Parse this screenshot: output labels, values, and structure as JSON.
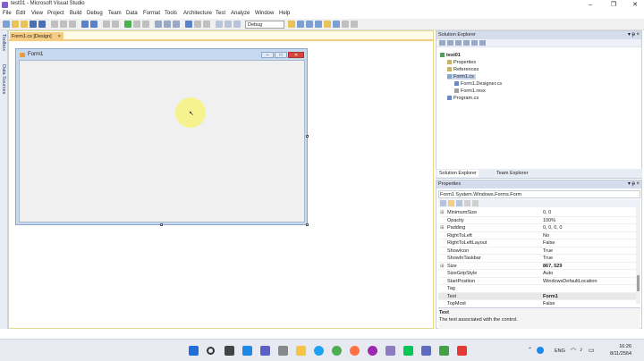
{
  "window": {
    "title": "test01 - Microsoft Visual Studio",
    "controls": [
      "–",
      "❐",
      "✕"
    ]
  },
  "menu": [
    "File",
    "Edit",
    "View",
    "Project",
    "Build",
    "Debug",
    "Team",
    "Data",
    "Format",
    "Tools",
    "Architecture",
    "Test",
    "Analyze",
    "Window",
    "Help"
  ],
  "toolbar": {
    "configuration": "Debug"
  },
  "left_tabs": {
    "toolbox": "Toolbox",
    "data_sources": "Data Sources"
  },
  "document_tab": {
    "label": "Form1.cs [Design]",
    "close": "×"
  },
  "form": {
    "caption": "Form1"
  },
  "solution_explorer": {
    "title": "Solution Explorer",
    "pin": "▾ ᵽ ×",
    "items": [
      {
        "label": "test01",
        "bold": true
      },
      {
        "label": "Properties"
      },
      {
        "label": "References"
      },
      {
        "label": "Form1.cs"
      },
      {
        "label": "Form1.Designer.cs"
      },
      {
        "label": "Form1.resx"
      },
      {
        "label": "Program.cs"
      }
    ],
    "tabs": [
      "Solution Explorer",
      "Team Explorer"
    ]
  },
  "properties": {
    "title": "Properties",
    "pin": "▾ ᵽ ×",
    "selected_object": "Form1 System.Windows.Forms.Form",
    "rows": [
      {
        "name": "MinimumSize",
        "value": "0, 0",
        "expand": "⊞"
      },
      {
        "name": "Opacity",
        "value": "100%"
      },
      {
        "name": "Padding",
        "value": "0, 0, 0, 0",
        "expand": "⊞"
      },
      {
        "name": "RightToLeft",
        "value": "No"
      },
      {
        "name": "RightToLeftLayout",
        "value": "False"
      },
      {
        "name": "ShowIcon",
        "value": "True"
      },
      {
        "name": "ShowInTaskbar",
        "value": "True"
      },
      {
        "name": "Size",
        "value": "867, 529",
        "bold": true,
        "expand": "⊞"
      },
      {
        "name": "SizeGripStyle",
        "value": "Auto"
      },
      {
        "name": "StartPosition",
        "value": "WindowsDefaultLocation"
      },
      {
        "name": "Tag",
        "value": ""
      },
      {
        "name": "Text",
        "value": "Form1",
        "bold": true
      },
      {
        "name": "TopMost",
        "value": "False"
      }
    ],
    "description_title": "Text",
    "description": "The text associated with the control."
  },
  "taskbar": {
    "language": "ENG",
    "time": "16:26",
    "date": "8/11/2564"
  },
  "colors": {
    "accent": "#f5cc84",
    "form_client": "#f0f0f0",
    "cursor_highlight": "#f6f38e"
  }
}
